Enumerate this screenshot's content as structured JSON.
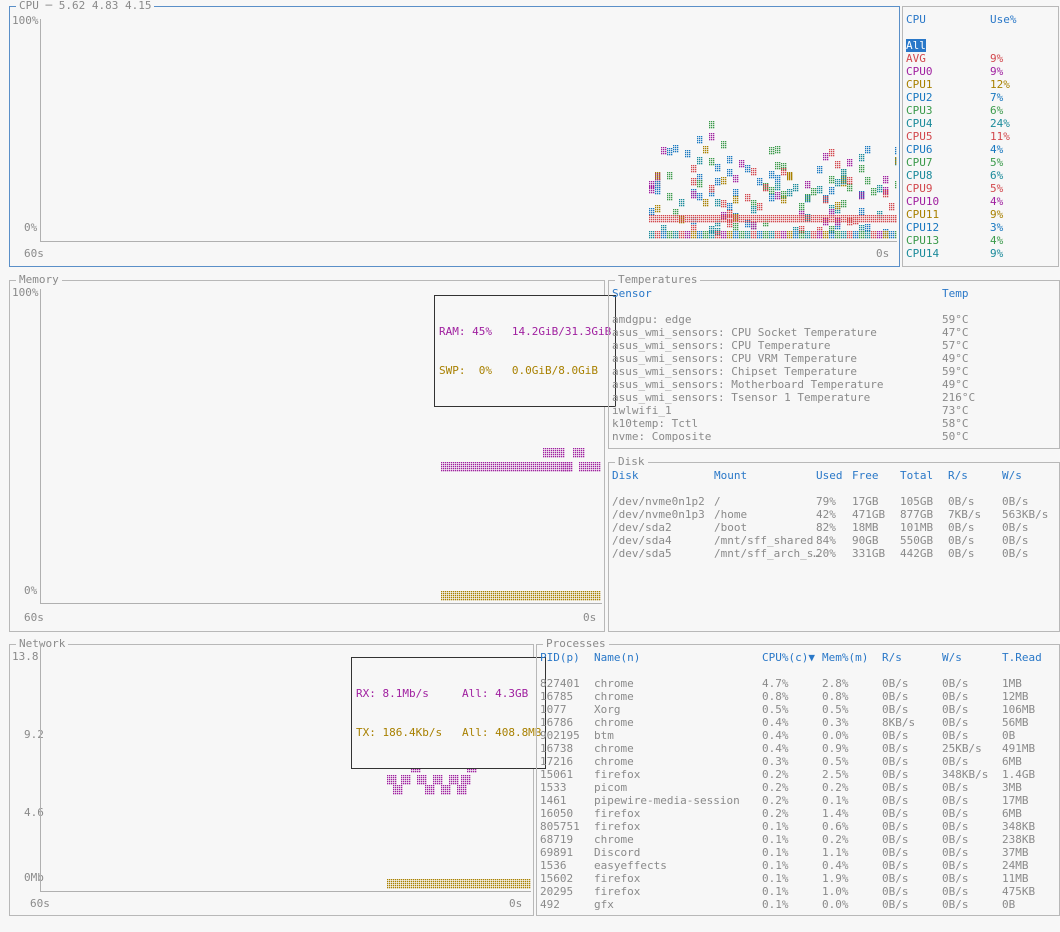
{
  "cpu": {
    "title": "CPU",
    "load": "5.62 4.83 4.15",
    "y_top": "100%",
    "y_bottom": "0%",
    "x_left": "60s",
    "x_right": "0s",
    "list_header": {
      "name": "CPU",
      "use": "Use%"
    },
    "selected": "All",
    "rows": [
      {
        "name": "AVG",
        "use": "9%",
        "color": "#d2484d"
      },
      {
        "name": "CPU0",
        "use": "9%",
        "color": "#a020a0"
      },
      {
        "name": "CPU1",
        "use": "12%",
        "color": "#a88000"
      },
      {
        "name": "CPU2",
        "use": "7%",
        "color": "#1878c0"
      },
      {
        "name": "CPU3",
        "use": "6%",
        "color": "#3a9a4a"
      },
      {
        "name": "CPU4",
        "use": "24%",
        "color": "#1a8a9a"
      },
      {
        "name": "CPU5",
        "use": "11%",
        "color": "#d2484d"
      },
      {
        "name": "CPU6",
        "use": "4%",
        "color": "#1878c0"
      },
      {
        "name": "CPU7",
        "use": "5%",
        "color": "#3a9a4a"
      },
      {
        "name": "CPU8",
        "use": "6%",
        "color": "#1a8a9a"
      },
      {
        "name": "CPU9",
        "use": "5%",
        "color": "#d2484d"
      },
      {
        "name": "CPU10",
        "use": "4%",
        "color": "#a020a0"
      },
      {
        "name": "CPU11",
        "use": "9%",
        "color": "#a88000"
      },
      {
        "name": "CPU12",
        "use": "3%",
        "color": "#1878c0"
      },
      {
        "name": "CPU13",
        "use": "4%",
        "color": "#3a9a4a"
      },
      {
        "name": "CPU14",
        "use": "9%",
        "color": "#1a8a9a"
      }
    ]
  },
  "memory": {
    "title": "Memory",
    "y_top": "100%",
    "y_bottom": "0%",
    "x_left": "60s",
    "x_right": "0s",
    "ram_line": "RAM: 45%   14.2GiB/31.3GiB",
    "swp_line": "SWP:  0%   0.0GiB/8.0GiB",
    "ram_color": "#a020a0",
    "swp_color": "#a88000",
    "ram_pct": 45,
    "swp_pct": 0
  },
  "temperatures": {
    "title": "Temperatures",
    "headers": {
      "sensor": "Sensor",
      "temp": "Temp"
    },
    "rows": [
      {
        "sensor": "amdgpu: edge",
        "temp": "59°C"
      },
      {
        "sensor": "asus_wmi_sensors: CPU Socket Temperature",
        "temp": "47°C"
      },
      {
        "sensor": "asus_wmi_sensors: CPU Temperature",
        "temp": "57°C"
      },
      {
        "sensor": "asus_wmi_sensors: CPU VRM Temperature",
        "temp": "49°C"
      },
      {
        "sensor": "asus_wmi_sensors: Chipset Temperature",
        "temp": "59°C"
      },
      {
        "sensor": "asus_wmi_sensors: Motherboard Temperature",
        "temp": "49°C"
      },
      {
        "sensor": "asus_wmi_sensors: Tsensor 1 Temperature",
        "temp": "216°C"
      },
      {
        "sensor": "iwlwifi_1",
        "temp": "73°C"
      },
      {
        "sensor": "k10temp: Tctl",
        "temp": "58°C"
      },
      {
        "sensor": "nvme: Composite",
        "temp": "50°C"
      }
    ]
  },
  "disk": {
    "title": "Disk",
    "headers": {
      "disk": "Disk",
      "mount": "Mount",
      "used": "Used",
      "free": "Free",
      "total": "Total",
      "rs": "R/s",
      "ws": "W/s"
    },
    "rows": [
      {
        "disk": "/dev/nvme0n1p2",
        "mount": "/",
        "used": "79%",
        "free": "17GB",
        "total": "105GB",
        "rs": "0B/s",
        "ws": "0B/s"
      },
      {
        "disk": "/dev/nvme0n1p3",
        "mount": "/home",
        "used": "42%",
        "free": "471GB",
        "total": "877GB",
        "rs": "7KB/s",
        "ws": "563KB/s"
      },
      {
        "disk": "/dev/sda2",
        "mount": "/boot",
        "used": "82%",
        "free": "18MB",
        "total": "101MB",
        "rs": "0B/s",
        "ws": "0B/s"
      },
      {
        "disk": "/dev/sda4",
        "mount": "/mnt/sff_shared",
        "used": "84%",
        "free": "90GB",
        "total": "550GB",
        "rs": "0B/s",
        "ws": "0B/s"
      },
      {
        "disk": "/dev/sda5",
        "mount": "/mnt/sff_arch_s…",
        "used": "20%",
        "free": "331GB",
        "total": "442GB",
        "rs": "0B/s",
        "ws": "0B/s"
      }
    ]
  },
  "network": {
    "title": "Network",
    "y_ticks": [
      "13.8",
      "9.2",
      "4.6",
      "0Mb"
    ],
    "x_left": "60s",
    "x_right": "0s",
    "rx_line": "RX: 8.1Mb/s     All: 4.3GB",
    "tx_line": "TX: 186.4Kb/s   All: 408.8MB",
    "rx_color": "#a020a0",
    "tx_color": "#a88000"
  },
  "processes": {
    "title": "Processes",
    "headers": {
      "pid": "PID(p)",
      "name": "Name(n)",
      "cpu": "CPU%(c)▼",
      "mem": "Mem%(m)",
      "rs": "R/s",
      "ws": "W/s",
      "tread": "T.Read"
    },
    "rows": [
      {
        "pid": "827401",
        "name": "chrome",
        "cpu": "4.7%",
        "mem": "2.8%",
        "rs": "0B/s",
        "ws": "0B/s",
        "tread": "1MB"
      },
      {
        "pid": "16785",
        "name": "chrome",
        "cpu": "0.8%",
        "mem": "0.8%",
        "rs": "0B/s",
        "ws": "0B/s",
        "tread": "12MB"
      },
      {
        "pid": "1077",
        "name": "Xorg",
        "cpu": "0.5%",
        "mem": "0.5%",
        "rs": "0B/s",
        "ws": "0B/s",
        "tread": "106MB"
      },
      {
        "pid": "16786",
        "name": "chrome",
        "cpu": "0.4%",
        "mem": "0.3%",
        "rs": "8KB/s",
        "ws": "0B/s",
        "tread": "56MB"
      },
      {
        "pid": "902195",
        "name": "btm",
        "cpu": "0.4%",
        "mem": "0.0%",
        "rs": "0B/s",
        "ws": "0B/s",
        "tread": "0B"
      },
      {
        "pid": "16738",
        "name": "chrome",
        "cpu": "0.4%",
        "mem": "0.9%",
        "rs": "0B/s",
        "ws": "25KB/s",
        "tread": "491MB"
      },
      {
        "pid": "17216",
        "name": "chrome",
        "cpu": "0.3%",
        "mem": "0.5%",
        "rs": "0B/s",
        "ws": "0B/s",
        "tread": "6MB"
      },
      {
        "pid": "15061",
        "name": "firefox",
        "cpu": "0.2%",
        "mem": "2.5%",
        "rs": "0B/s",
        "ws": "348KB/s",
        "tread": "1.4GB"
      },
      {
        "pid": "1533",
        "name": "picom",
        "cpu": "0.2%",
        "mem": "0.2%",
        "rs": "0B/s",
        "ws": "0B/s",
        "tread": "3MB"
      },
      {
        "pid": "1461",
        "name": "pipewire-media-session",
        "cpu": "0.2%",
        "mem": "0.1%",
        "rs": "0B/s",
        "ws": "0B/s",
        "tread": "17MB"
      },
      {
        "pid": "16050",
        "name": "firefox",
        "cpu": "0.2%",
        "mem": "1.4%",
        "rs": "0B/s",
        "ws": "0B/s",
        "tread": "6MB"
      },
      {
        "pid": "805751",
        "name": "firefox",
        "cpu": "0.1%",
        "mem": "0.6%",
        "rs": "0B/s",
        "ws": "0B/s",
        "tread": "348KB"
      },
      {
        "pid": "68719",
        "name": "chrome",
        "cpu": "0.1%",
        "mem": "0.2%",
        "rs": "0B/s",
        "ws": "0B/s",
        "tread": "238KB"
      },
      {
        "pid": "69891",
        "name": "Discord",
        "cpu": "0.1%",
        "mem": "1.1%",
        "rs": "0B/s",
        "ws": "0B/s",
        "tread": "37MB"
      },
      {
        "pid": "1536",
        "name": "easyeffects",
        "cpu": "0.1%",
        "mem": "0.4%",
        "rs": "0B/s",
        "ws": "0B/s",
        "tread": "24MB"
      },
      {
        "pid": "15602",
        "name": "firefox",
        "cpu": "0.1%",
        "mem": "1.9%",
        "rs": "0B/s",
        "ws": "0B/s",
        "tread": "11MB"
      },
      {
        "pid": "20295",
        "name": "firefox",
        "cpu": "0.1%",
        "mem": "1.0%",
        "rs": "0B/s",
        "ws": "0B/s",
        "tread": "475KB"
      },
      {
        "pid": "492",
        "name": "gfx",
        "cpu": "0.1%",
        "mem": "0.0%",
        "rs": "0B/s",
        "ws": "0B/s",
        "tread": "0B"
      }
    ]
  }
}
